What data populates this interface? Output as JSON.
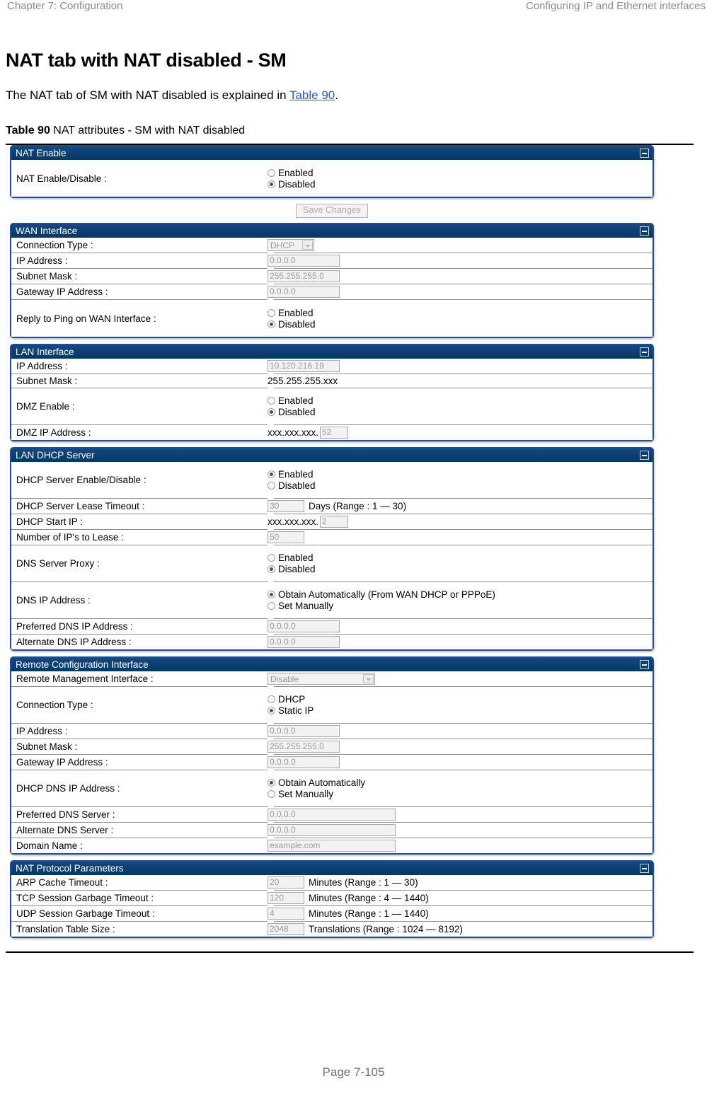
{
  "running_head": {
    "left": "Chapter 7:  Configuration",
    "right": "Configuring IP and Ethernet interfaces"
  },
  "page_title": "NAT tab with NAT disabled - SM",
  "intro": {
    "before": "The NAT tab of SM with NAT disabled is explained in ",
    "xref": "Table 90",
    "after": "."
  },
  "caption": {
    "label": "Table 90",
    "text": " NAT attributes - SM with NAT disabled"
  },
  "footer": "Page 7-105",
  "colors": {
    "panel_header_bg": "#0b3f75",
    "panel_border": "#1d4f91",
    "xref_link": "#2b59d8",
    "disabled_text": "#9a9a9a",
    "tick_mark": "#d0352c"
  },
  "save_button": "Save Changes",
  "collapse_icon": "minus-box-icon",
  "panels": [
    {
      "title": "NAT Enable",
      "rows": [
        {
          "label": "NAT Enable/Disable :",
          "type": "radio",
          "options": [
            {
              "label": "Enabled",
              "selected": false
            },
            {
              "label": "Disabled",
              "selected": true
            }
          ]
        }
      ]
    },
    {
      "title": "WAN Interface",
      "rows": [
        {
          "label": "Connection Type :",
          "type": "select",
          "value": "DHCP",
          "width": "w1"
        },
        {
          "label": "IP Address :",
          "type": "text",
          "value": "0.0.0.0",
          "width": "w-ip"
        },
        {
          "label": "Subnet Mask :",
          "type": "text",
          "value": "255.255.255.0",
          "width": "w-ip"
        },
        {
          "label": "Gateway IP Address :",
          "type": "text",
          "value": "0.0.0.0",
          "width": "w-ip"
        },
        {
          "label": "Reply to Ping on WAN Interface :",
          "type": "radio",
          "options": [
            {
              "label": "Enabled",
              "selected": false
            },
            {
              "label": "Disabled",
              "selected": true
            }
          ]
        }
      ]
    },
    {
      "title": "LAN Interface",
      "rows": [
        {
          "label": "IP Address :",
          "type": "text",
          "value": "10.120.216.19",
          "width": "w-ip"
        },
        {
          "label": "Subnet Mask :",
          "type": "plain",
          "value": "255.255.255.xxx"
        },
        {
          "label": "DMZ Enable :",
          "type": "radio",
          "options": [
            {
              "label": "Enabled",
              "selected": false
            },
            {
              "label": "Disabled",
              "selected": true
            }
          ]
        },
        {
          "label": "DMZ IP Address :",
          "type": "prefix-text",
          "prefix": "xxx.xxx.xxx.",
          "value": "52",
          "width": "w-oct"
        }
      ]
    },
    {
      "title": "LAN DHCP Server",
      "rows": [
        {
          "label": "DHCP Server Enable/Disable :",
          "type": "radio",
          "options": [
            {
              "label": "Enabled",
              "selected": true
            },
            {
              "label": "Disabled",
              "selected": false
            }
          ]
        },
        {
          "label": "DHCP Server Lease Timeout :",
          "type": "text-unit",
          "value": "30",
          "unit": "Days (Range : 1 — 30)",
          "width": "w-num"
        },
        {
          "label": "DHCP Start IP :",
          "type": "prefix-text",
          "prefix": "xxx.xxx.xxx.",
          "value": "2",
          "width": "w-oct"
        },
        {
          "label": "Number of IP's to Lease :",
          "type": "text",
          "value": "50",
          "width": "w-num"
        },
        {
          "label": "DNS Server Proxy :",
          "type": "radio",
          "options": [
            {
              "label": "Enabled",
              "selected": false
            },
            {
              "label": "Disabled",
              "selected": true
            }
          ]
        },
        {
          "label": "DNS IP Address :",
          "type": "radio",
          "options": [
            {
              "label": "Obtain Automatically (From WAN DHCP or PPPoE)",
              "selected": true
            },
            {
              "label": "Set Manually",
              "selected": false
            }
          ]
        },
        {
          "label": "Preferred DNS IP Address :",
          "type": "text",
          "value": "0.0.0.0",
          "width": "w-ip"
        },
        {
          "label": "Alternate DNS IP Address :",
          "type": "text",
          "value": "0.0.0.0",
          "width": "w-ip"
        }
      ]
    },
    {
      "title": "Remote Configuration Interface",
      "rows": [
        {
          "label": "Remote Management Interface :",
          "type": "select",
          "value": "Disable",
          "width": "w2"
        },
        {
          "label": "Connection Type :",
          "type": "radio",
          "options": [
            {
              "label": "DHCP",
              "selected": false
            },
            {
              "label": "Static IP",
              "selected": true
            }
          ]
        },
        {
          "label": "IP Address :",
          "type": "text",
          "value": "0.0.0.0",
          "width": "w-ip"
        },
        {
          "label": "Subnet Mask :",
          "type": "text",
          "value": "255.255.255.0",
          "width": "w-ip"
        },
        {
          "label": "Gateway IP Address :",
          "type": "text",
          "value": "0.0.0.0",
          "width": "w-ip"
        },
        {
          "label": "DHCP DNS IP Address :",
          "type": "radio",
          "options": [
            {
              "label": "Obtain Automatically",
              "selected": true
            },
            {
              "label": "Set Manually",
              "selected": false
            }
          ]
        },
        {
          "label": "Preferred DNS Server :",
          "type": "text",
          "value": "0.0.0.0",
          "width": "w-ip2"
        },
        {
          "label": "Alternate DNS Server :",
          "type": "text",
          "value": "0.0.0.0",
          "width": "w-ip2"
        },
        {
          "label": "Domain Name :",
          "type": "text",
          "value": "example.com",
          "width": "w-ip2"
        }
      ]
    },
    {
      "title": "NAT Protocol Parameters",
      "rows": [
        {
          "label": "ARP Cache Timeout :",
          "type": "text-unit",
          "value": "20",
          "unit": "Minutes (Range : 1 — 30)",
          "width": "w-num"
        },
        {
          "label": "TCP Session Garbage Timeout :",
          "type": "text-unit",
          "value": "120",
          "unit": "Minutes (Range : 4 — 1440)",
          "width": "w-num"
        },
        {
          "label": "UDP Session Garbage Timeout :",
          "type": "text-unit",
          "value": "4",
          "unit": "Minutes (Range : 1 — 1440)",
          "width": "w-num"
        },
        {
          "label": "Translation Table Size :",
          "type": "text-unit",
          "value": "2048",
          "unit": "Translations (Range : 1024 — 8192)",
          "width": "w-num"
        }
      ]
    }
  ]
}
